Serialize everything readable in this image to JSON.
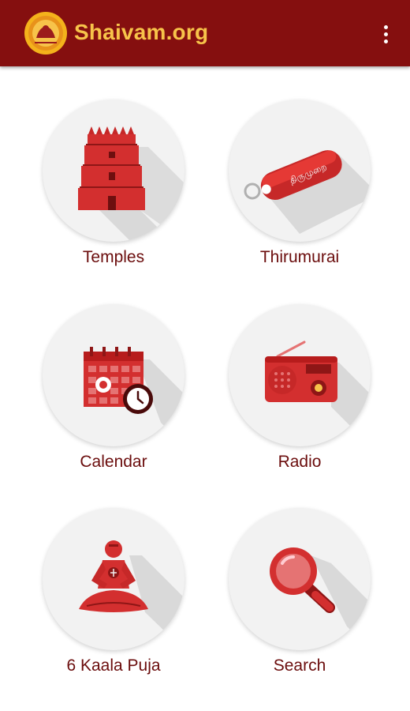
{
  "app_bar": {
    "title": "Shaivam.org",
    "logo_icon": "shaivam-logo-icon",
    "overflow_icon": "more-vert-icon"
  },
  "colors": {
    "primary": "#850f0f",
    "title_accent": "#f7c34a",
    "icon_red": "#d32f2f",
    "label": "#6b0d0d"
  },
  "menu": [
    {
      "label": "Temples",
      "icon": "temple-icon"
    },
    {
      "label": "Thirumurai",
      "icon": "thirumurai-icon",
      "icon_text": "திருமுறை"
    },
    {
      "label": "Calendar",
      "icon": "calendar-icon"
    },
    {
      "label": "Radio",
      "icon": "radio-icon"
    },
    {
      "label": "6 Kaala Puja",
      "icon": "puja-icon"
    },
    {
      "label": "Search",
      "icon": "search-icon"
    }
  ]
}
